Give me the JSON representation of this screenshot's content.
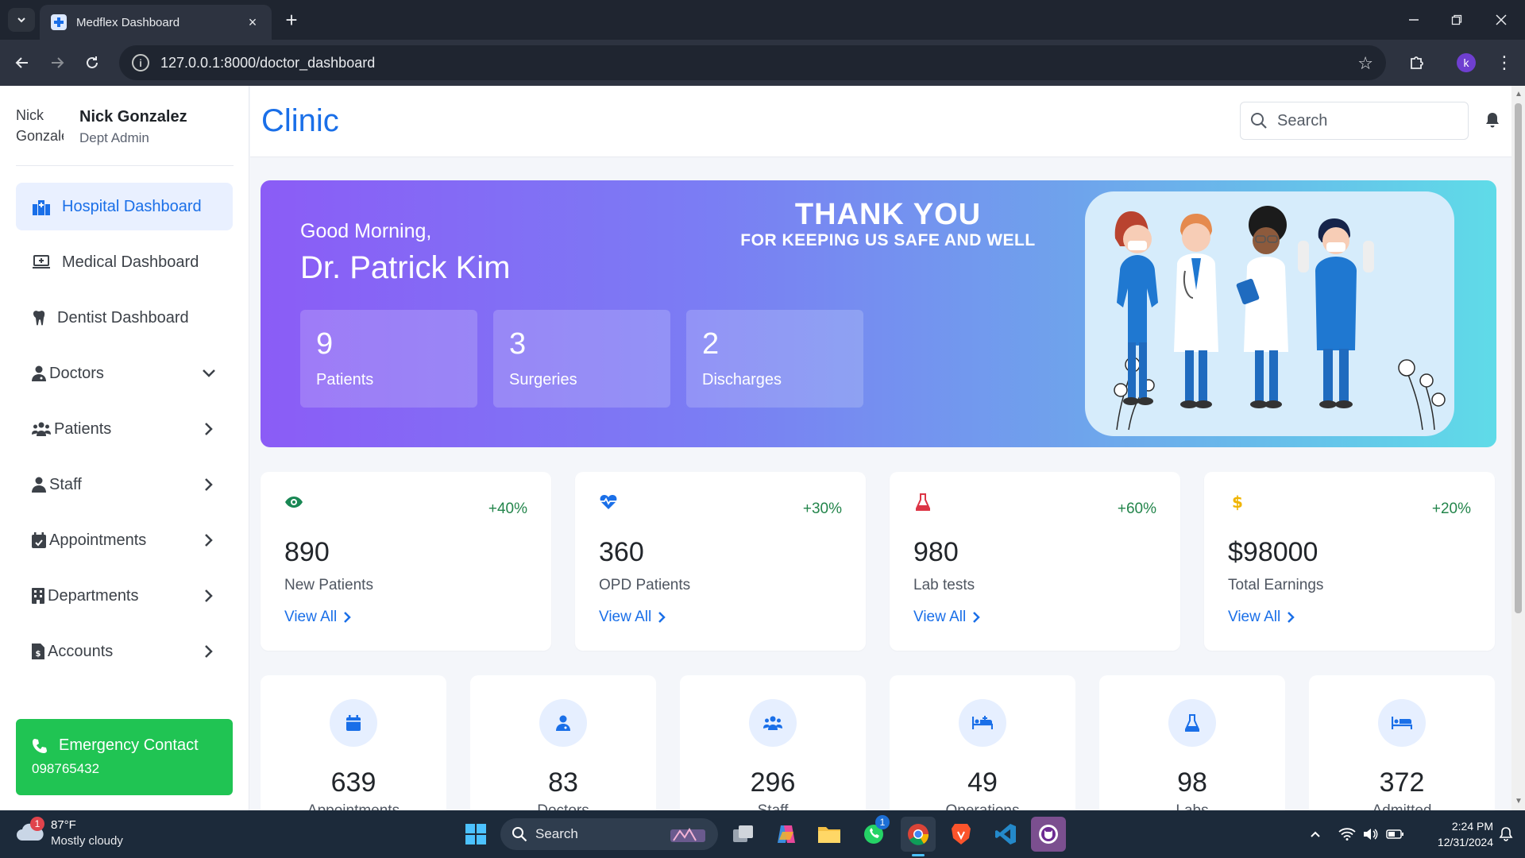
{
  "browser": {
    "tab_title": "Medflex Dashboard",
    "url": "127.0.0.1:8000/doctor_dashboard",
    "profile_initial": "k"
  },
  "user": {
    "name": "Nick Gonzalez",
    "role": "Dept Admin",
    "avatar_alt": "Nick Gonzalez"
  },
  "sidebar": {
    "items": [
      {
        "label": "Hospital Dashboard",
        "icon": "hospital-icon"
      },
      {
        "label": "Medical Dashboard",
        "icon": "medical-laptop-icon"
      },
      {
        "label": "Dentist Dashboard",
        "icon": "tooth-icon"
      },
      {
        "label": "Doctors",
        "icon": "doctor-icon"
      },
      {
        "label": "Patients",
        "icon": "patients-icon"
      },
      {
        "label": "Staff",
        "icon": "staff-icon"
      },
      {
        "label": "Appointments",
        "icon": "calendar-icon"
      },
      {
        "label": "Departments",
        "icon": "building-icon"
      },
      {
        "label": "Accounts",
        "icon": "invoice-icon"
      }
    ],
    "emergency": {
      "title": "Emergency Contact",
      "phone": "098765432"
    }
  },
  "header": {
    "brand": "Clinic",
    "search_placeholder": "Search"
  },
  "hero": {
    "greeting": "Good Morning,",
    "doctor": "Dr. Patrick Kim",
    "thanks_title": "THANK YOU",
    "thanks_sub": "FOR KEEPING US SAFE AND WELL",
    "stats": [
      {
        "value": "9",
        "label": "Patients"
      },
      {
        "value": "3",
        "label": "Surgeries"
      },
      {
        "value": "2",
        "label": "Discharges"
      }
    ]
  },
  "cards": [
    {
      "value": "890",
      "label": "New Patients",
      "pct": "+40%",
      "link": "View All",
      "icon": "eye-icon",
      "color": "#198754"
    },
    {
      "value": "360",
      "label": "OPD Patients",
      "pct": "+30%",
      "link": "View All",
      "icon": "heartbeat-icon",
      "color": "#1a6fe8"
    },
    {
      "value": "980",
      "label": "Lab tests",
      "pct": "+60%",
      "link": "View All",
      "icon": "flask-icon",
      "color": "#dc3545"
    },
    {
      "value": "$98000",
      "label": "Total Earnings",
      "pct": "+20%",
      "link": "View All",
      "icon": "dollar-icon",
      "color": "#f0b400"
    }
  ],
  "mini_stats": [
    {
      "value": "639",
      "label": "Appointments",
      "icon": "calendar-icon"
    },
    {
      "value": "83",
      "label": "Doctors",
      "icon": "doctor-icon"
    },
    {
      "value": "296",
      "label": "Staff",
      "icon": "users-icon"
    },
    {
      "value": "49",
      "label": "Operations",
      "icon": "operation-bed-icon"
    },
    {
      "value": "98",
      "label": "Labs",
      "icon": "flask-icon"
    },
    {
      "value": "372",
      "label": "Admitted",
      "icon": "bed-icon"
    }
  ],
  "taskbar": {
    "weather_temp": "87°F",
    "weather_desc": "Mostly cloudy",
    "weather_badge": "1",
    "search": "Search",
    "whatsapp_badge": "1",
    "time": "2:24 PM",
    "date": "12/31/2024"
  },
  "colors": {
    "accent": "#1a6fe8",
    "emergency": "#20c453",
    "positive": "#23854b"
  }
}
